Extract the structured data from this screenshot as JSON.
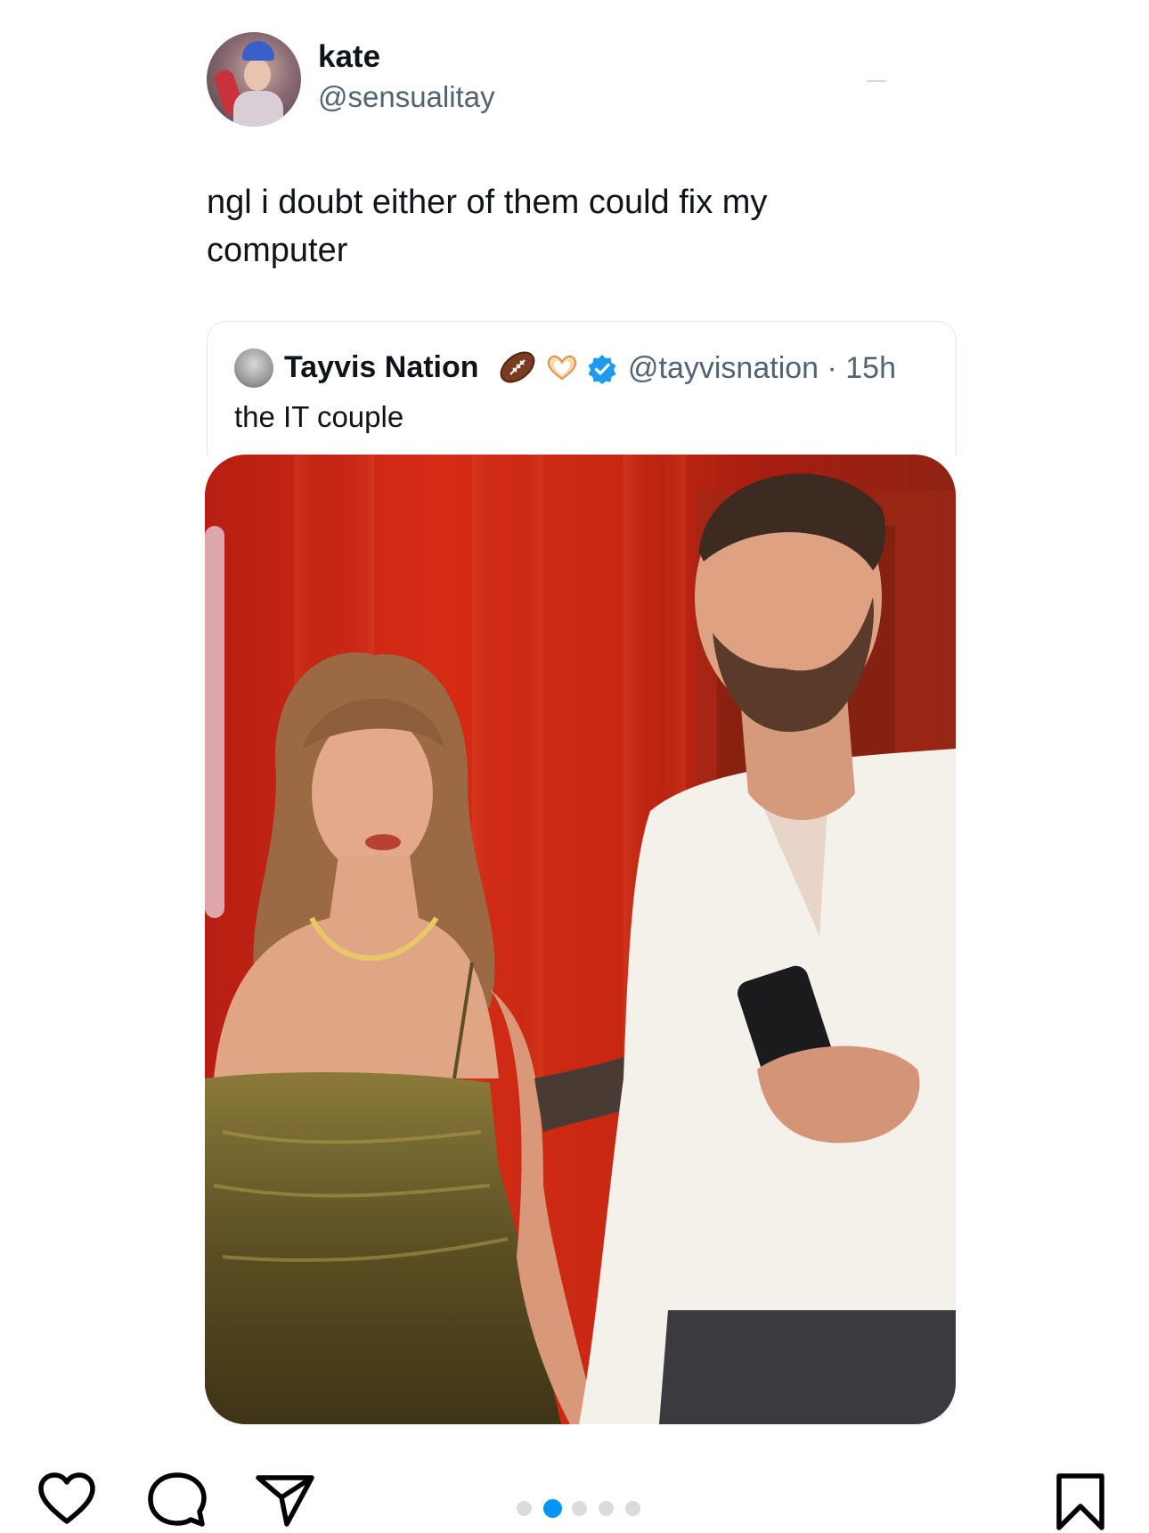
{
  "post": {
    "author": {
      "display_name": "kate",
      "handle": "@sensualitay",
      "avatar": "profile-photo"
    },
    "text": "ngl i doubt either of them could fix my computer",
    "quoted": {
      "display_name": "Tayvis Nation",
      "badges": [
        "football-icon",
        "heart-hands-icon",
        "verified-icon"
      ],
      "meta": "@tayvisnation · 15h",
      "text": "the IT couple"
    },
    "image": "photo-couple-red-background"
  },
  "actions": {
    "icons": [
      "heart-icon",
      "comment-icon",
      "share-icon",
      "bookmark-icon"
    ]
  },
  "carousel": {
    "count": 5,
    "active_index": 1,
    "active_color": "#0095f6"
  },
  "colors": {
    "verified": "#1d9bf0",
    "handle": "#536471"
  }
}
